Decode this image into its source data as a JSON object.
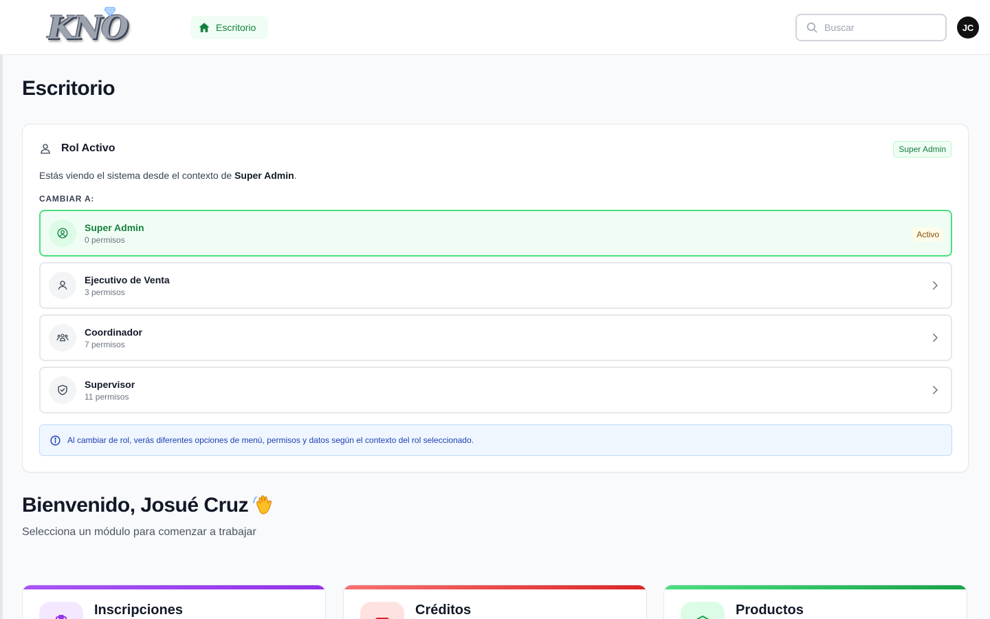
{
  "header": {
    "logo_text": "KNO",
    "nav_home_label": "Escritorio",
    "search_placeholder": "Buscar",
    "user_initials": "JC"
  },
  "page": {
    "title": "Escritorio"
  },
  "role_card": {
    "title": "Rol Activo",
    "current_role_badge": "Super Admin",
    "context_prefix": "Estás viendo el sistema desde el contexto de ",
    "context_role": "Super Admin",
    "context_suffix": ".",
    "change_label": "CAMBIAR A:",
    "roles": [
      {
        "name": "Super Admin",
        "permissions": "0 permisos",
        "icon": "user-circle-icon",
        "active": true,
        "status": "Activo"
      },
      {
        "name": "Ejecutivo de Venta",
        "permissions": "3 permisos",
        "icon": "user-icon",
        "active": false
      },
      {
        "name": "Coordinador",
        "permissions": "7 permisos",
        "icon": "users-group-icon",
        "active": false
      },
      {
        "name": "Supervisor",
        "permissions": "11 permisos",
        "icon": "shield-check-icon",
        "active": false
      }
    ],
    "info_text": "Al cambiar de rol, verás diferentes opciones de menú, permisos y datos según el contexto del rol seleccionado."
  },
  "welcome": {
    "title": "Bienvenido, Josué Cruz",
    "subtitle": "Selecciona un módulo para comenzar a trabajar"
  },
  "modules": [
    {
      "title": "Inscripciones",
      "icon": "clipboard-icon",
      "accent": "#a855f7",
      "bg": "#f3e8ff"
    },
    {
      "title": "Créditos",
      "icon": "card-icon",
      "accent": "#ef4444",
      "bg": "#fee2e2"
    },
    {
      "title": "Productos",
      "icon": "box-icon",
      "accent": "#22c55e",
      "bg": "#dcfce7"
    }
  ],
  "colors": {
    "primary_green": "#15803d",
    "active_border": "#4ade80",
    "info_blue": "#1e40af"
  }
}
